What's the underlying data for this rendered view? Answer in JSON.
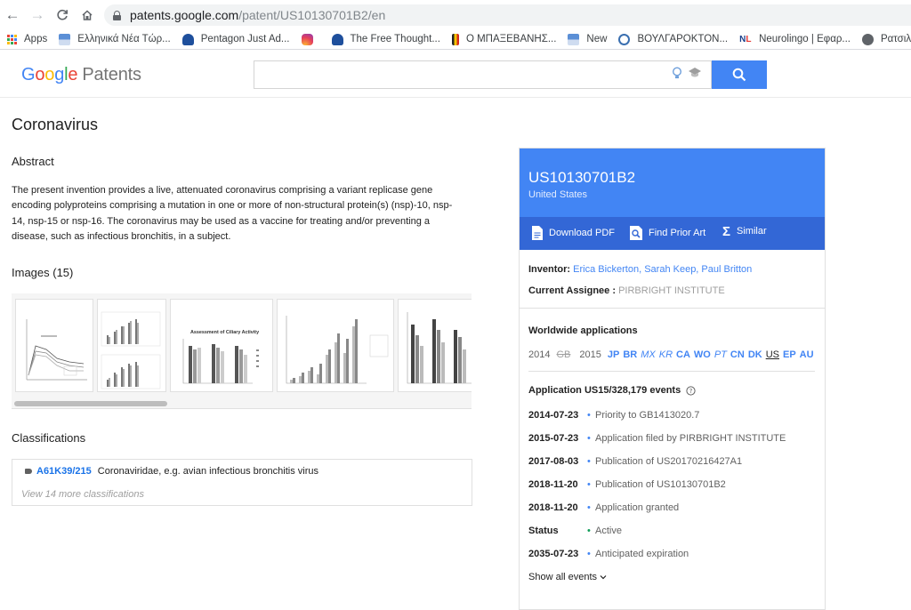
{
  "browser": {
    "url_host": "patents.google.com",
    "url_path": "/patent/US10130701B2/en",
    "bookmarks": [
      {
        "label": "Apps",
        "icon": "apps-grid-icon"
      },
      {
        "label": "Ελληνικά Νέα Τώρ...",
        "icon": "news-site-icon"
      },
      {
        "label": "Pentagon Just Ad...",
        "icon": "head-silhouette-icon"
      },
      {
        "label": "",
        "icon": "instagram-icon"
      },
      {
        "label": "The Free Thought...",
        "icon": "head-silhouette-icon"
      },
      {
        "label": "Ο ΜΠΑΞΕΒΑΝΗΣ...",
        "icon": "flag-icon"
      },
      {
        "label": "New",
        "icon": "news-site-icon"
      },
      {
        "label": "ΒΟΥΛΓΑΡΟΚΤΟΝ...",
        "icon": "circle-logo-icon"
      },
      {
        "label": "Neurolingo | Εφαρ...",
        "icon": "nl-logo-icon"
      },
      {
        "label": "Ρατσιλντ",
        "icon": "globe-icon"
      }
    ]
  },
  "header": {
    "logo_google": "Google",
    "logo_patents": "Patents",
    "search_placeholder": ""
  },
  "patent": {
    "title": "Coronavirus",
    "abstract_heading": "Abstract",
    "abstract": "The present invention provides a live, attenuated coronavirus comprising a variant replicase gene encoding polyproteins comprising a mutation in one or more of non-structural protein(s) (nsp)-10, nsp-14, nsp-15 or nsp-16. The coronavirus may be used as a vaccine for treating and/or preventing a disease, such as infectious bronchitis, in a subject.",
    "images_heading": "Images (15)",
    "classifications_heading": "Classifications",
    "classification_code": "A61K39/215",
    "classification_desc": "Coronaviridae, e.g. avian infectious bronchitis virus",
    "more_classifications": "View 14 more classifications",
    "thumb_titles": [
      "",
      "",
      "Assessment of Ciliary Activity",
      "",
      ""
    ]
  },
  "card": {
    "publication_number": "US10130701B2",
    "country": "United States",
    "actions": {
      "download": "Download PDF",
      "prior_art": "Find Prior Art",
      "similar": "Similar"
    },
    "inventor_label": "Inventor:",
    "inventors": "Erica Bickerton, Sarah Keep, Paul Britton",
    "assignee_label": "Current Assignee :",
    "assignee": "PIRBRIGHT INSTITUTE",
    "worldwide_heading": "Worldwide applications",
    "year_2014": "2014",
    "cc_gb": "GB",
    "year_2015": "2015",
    "countries_2015": [
      "JP",
      "BR",
      "MX",
      "KR",
      "CA",
      "WO",
      "PT",
      "CN",
      "DK",
      "US",
      "EP",
      "AU"
    ],
    "events_heading": "Application US15/328,179 events",
    "events": [
      {
        "date": "2014-07-23",
        "text": "Priority to GB1413020.7"
      },
      {
        "date": "2015-07-23",
        "text": "Application filed by PIRBRIGHT INSTITUTE"
      },
      {
        "date": "2017-08-03",
        "text": "Publication of US20170216427A1"
      },
      {
        "date": "2018-11-20",
        "text": "Publication of US10130701B2"
      },
      {
        "date": "2018-11-20",
        "text": "Application granted"
      },
      {
        "date": "Status",
        "text": "Active"
      },
      {
        "date": "2035-07-23",
        "text": "Anticipated expiration"
      }
    ],
    "show_all": "Show all events"
  },
  "colors": {
    "accent": "#4285f4",
    "accent_dark": "#3367d6",
    "status_active": "#0f9d58"
  }
}
